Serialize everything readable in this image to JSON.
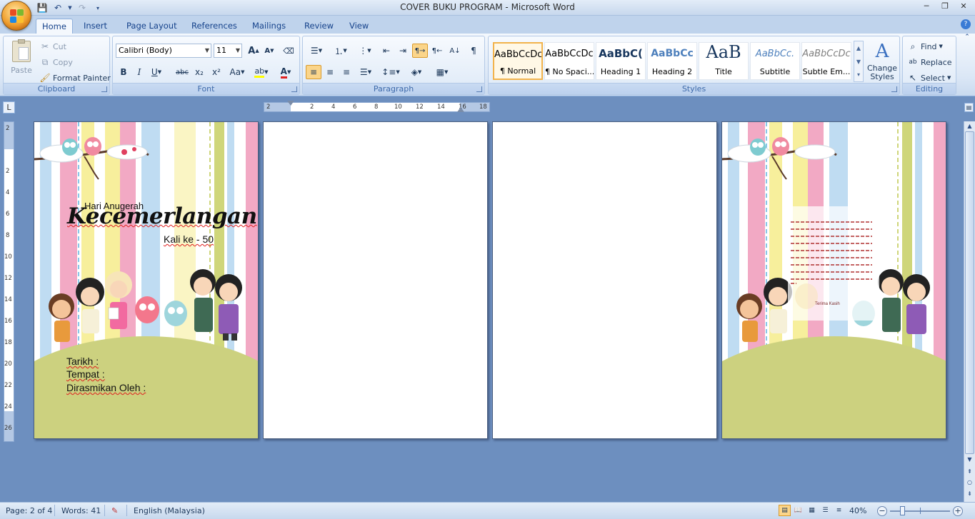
{
  "window": {
    "title": "COVER BUKU PROGRAM - Microsoft Word",
    "controls": {
      "minimize": "─",
      "restore": "❐",
      "close": "✕"
    }
  },
  "tabs": [
    {
      "label": "Home",
      "active": true
    },
    {
      "label": "Insert"
    },
    {
      "label": "Page Layout"
    },
    {
      "label": "References"
    },
    {
      "label": "Mailings"
    },
    {
      "label": "Review"
    },
    {
      "label": "View"
    }
  ],
  "clipboard": {
    "group_label": "Clipboard",
    "paste": "Paste",
    "cut": "Cut",
    "copy": "Copy",
    "format_painter": "Format Painter"
  },
  "font": {
    "group_label": "Font",
    "font_name": "Calibri (Body)",
    "font_size": "11",
    "bold": "B",
    "italic": "I",
    "underline": "U",
    "strike": "abc",
    "subscript": "x₂",
    "superscript": "x²",
    "change_case": "Aa",
    "grow": "A",
    "shrink": "A"
  },
  "paragraph": {
    "group_label": "Paragraph"
  },
  "styles": {
    "group_label": "Styles",
    "items": [
      {
        "sample": "AaBbCcDc",
        "name": "¶ Normal",
        "selected": true
      },
      {
        "sample": "AaBbCcDc",
        "name": "¶ No Spaci..."
      },
      {
        "sample": "AaBbC(",
        "name": "Heading 1"
      },
      {
        "sample": "AaBbCc",
        "name": "Heading 2"
      },
      {
        "sample": "AaB",
        "name": "Title"
      },
      {
        "sample": "AaBbCc.",
        "name": "Subtitle"
      },
      {
        "sample": "AaBbCcDc",
        "name": "Subtle Em..."
      }
    ],
    "change_styles": "Change Styles"
  },
  "editing": {
    "group_label": "Editing",
    "find": "Find",
    "replace": "Replace",
    "select": "Select"
  },
  "ruler": {
    "h_ticks": [
      "2",
      "2",
      "4",
      "6",
      "8",
      "10",
      "12",
      "14",
      "16",
      "18"
    ],
    "v_ticks": [
      "2",
      "2",
      "4",
      "6",
      "8",
      "10",
      "12",
      "14",
      "16",
      "18",
      "20",
      "22",
      "24",
      "26"
    ]
  },
  "cover": {
    "subtitle": "Hari Anugerah",
    "title": "Kecemerlangan",
    "edition": "Kali ke - 50",
    "tarikh": "Tarikh :",
    "tempat": "Tempat :",
    "dirasmikan": "Dirasmikan Oleh :"
  },
  "back_cover": {
    "thanks": "Terima Kasih"
  },
  "status": {
    "page": "Page: 2 of 4",
    "words": "Words: 41",
    "language": "English (Malaysia)",
    "zoom": "40%"
  },
  "colors": {
    "stripe_pink": "#f2a9c4",
    "stripe_blue": "#bfdcf2",
    "stripe_yellow": "#f7ef9c",
    "stripe_green": "#cfd67a",
    "hill": "#ccd17f"
  }
}
